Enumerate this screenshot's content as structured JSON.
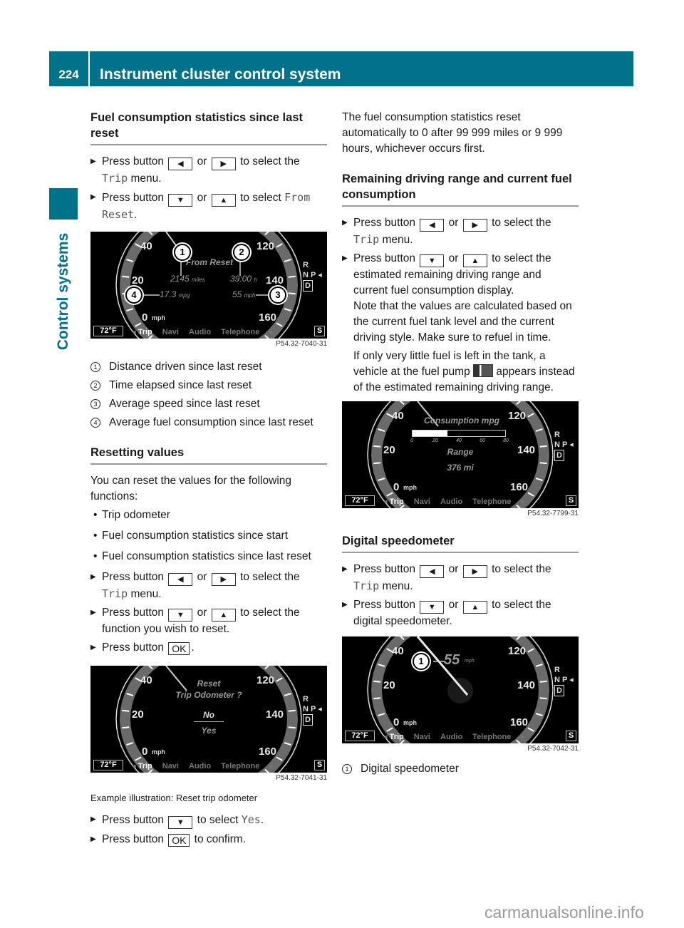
{
  "header": {
    "page_number": "224",
    "title": "Instrument cluster control system"
  },
  "side_tab": {
    "label": "Control systems",
    "color": "#00728a"
  },
  "buttons": {
    "left": "◀",
    "right": "▶",
    "down": "▼",
    "up": "▲",
    "ok": "OK"
  },
  "left": {
    "section1": {
      "heading": "Fuel consumption statistics since last reset",
      "step1": {
        "a": "Press button",
        "or": "or",
        "b": "to select the",
        "mono": "Trip",
        "c": "menu."
      },
      "step2": {
        "a": "Press button",
        "or": "or",
        "b": "to select",
        "mono": "From Reset",
        "c": "."
      },
      "figure": {
        "code": "P54.32-7040-31",
        "header": "From Reset",
        "distance": "2145",
        "distance_unit": "miles",
        "time": "39:00",
        "time_unit": "h",
        "consumption": "17.3",
        "consumption_unit": "mpg",
        "speed": "55",
        "speed_unit": "mph"
      },
      "legend": [
        {
          "n": "1",
          "text": "Distance driven since last reset"
        },
        {
          "n": "2",
          "text": "Time elapsed since last reset"
        },
        {
          "n": "3",
          "text": "Average speed since last reset"
        },
        {
          "n": "4",
          "text": "Average fuel consumption since last reset"
        }
      ]
    },
    "section2": {
      "heading": "Resetting values",
      "intro": "You can reset the values for the following functions:",
      "bullets": [
        "Trip odometer",
        "Fuel consumption statistics since start",
        "Fuel consumption statistics since last reset"
      ],
      "step1": {
        "a": "Press button",
        "or": "or",
        "b": "to select the",
        "mono": "Trip",
        "c": "menu."
      },
      "step2": {
        "a": "Press button",
        "or": "or",
        "b": "to select the function you wish to reset."
      },
      "step3": {
        "a": "Press button",
        "c": "."
      },
      "figure": {
        "code": "P54.32-7041-31",
        "line1": "Reset",
        "line2": "Trip Odometer ?",
        "opt_no": "No",
        "opt_yes": "Yes"
      },
      "caption": "Example illustration: Reset trip odometer",
      "step4": {
        "a": "Press button",
        "b": "to select",
        "mono": "Yes",
        "c": "."
      },
      "step5": {
        "a": "Press button",
        "b": "to confirm."
      }
    }
  },
  "right": {
    "auto_reset": "The fuel consumption statistics reset automatically to 0 after 99 999 miles or 9 999 hours, whichever occurs first.",
    "section3": {
      "heading": "Remaining driving range and current fuel consumption",
      "step1": {
        "a": "Press button",
        "or": "or",
        "b": "to select the",
        "mono": "Trip",
        "c": "menu."
      },
      "step2": {
        "a": "Press button",
        "or": "or",
        "b": "to select the estimated remaining driving range and current fuel consumption display.",
        "note": "Note that the values are calculated based on the current fuel tank level and the current driving style. Make sure to refuel in time.",
        "note2a": "If only very little fuel is left in the tank, a vehicle at the fuel pump",
        "note2b": "appears instead of the estimated remaining driving range."
      },
      "figure": {
        "code": "P54.32-7799-31",
        "title": "Consumption mpg",
        "scale": [
          "0",
          "20",
          "40",
          "60",
          "80"
        ],
        "consumption_value_mpg": 30,
        "range_label": "Range",
        "range_value": "376 mi"
      }
    },
    "section4": {
      "heading": "Digital speedometer",
      "step1": {
        "a": "Press button",
        "or": "or",
        "b": "to select the",
        "mono": "Trip",
        "c": "menu."
      },
      "step2": {
        "a": "Press button",
        "or": "or",
        "b": "to select the digital speedometer."
      },
      "figure": {
        "code": "P54.32-7042-31",
        "speed": "55",
        "unit": "mph"
      },
      "legend": [
        {
          "n": "1",
          "text": "Digital speedometer"
        }
      ]
    }
  },
  "cluster_common": {
    "ticks_left": [
      "40",
      "20",
      "0"
    ],
    "ticks_right": [
      "120",
      "140",
      "160"
    ],
    "mph": "mph",
    "temp": "72°F",
    "menu": [
      "Trip",
      "Navi",
      "Audio",
      "Telephone"
    ],
    "gears": [
      "R",
      "N",
      "P",
      "D"
    ],
    "s_button": "S"
  },
  "watermark": "carmanualsonline.info"
}
